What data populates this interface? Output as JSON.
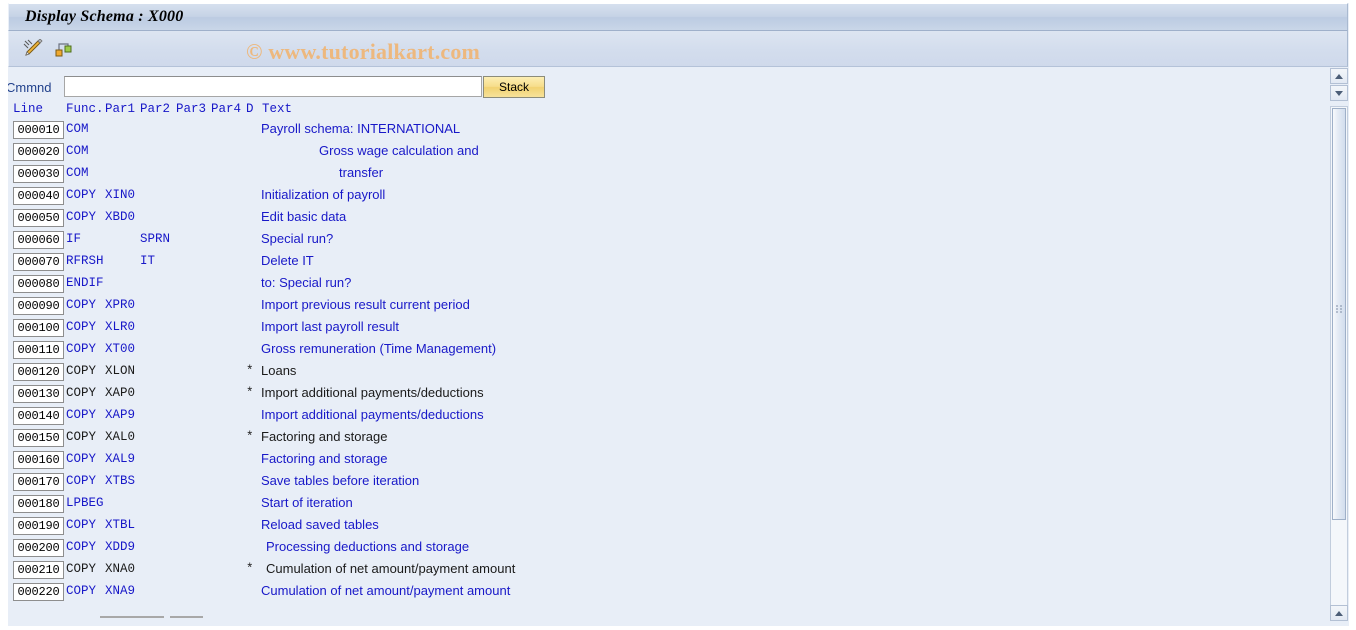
{
  "window": {
    "title": "Display Schema : X000"
  },
  "toolbar": {
    "icons": [
      {
        "name": "edit-pencil-icon",
        "tooltip": "Change"
      },
      {
        "name": "schema-structure-icon",
        "tooltip": "Structure"
      }
    ]
  },
  "watermark": {
    "text": "© www.tutorialkart.com",
    "color": "#edb87e"
  },
  "command": {
    "label": "Cmmnd",
    "value": "",
    "placeholder": "",
    "stack_label": "Stack"
  },
  "table": {
    "headers": {
      "line": "Line",
      "func": "Func.",
      "par1": "Par1",
      "par2": "Par2",
      "par3": "Par3",
      "par4": "Par4",
      "d": "D",
      "text": "Text"
    },
    "rows": [
      {
        "line": "000010",
        "func": "COM",
        "par1": "",
        "par2": "",
        "par3": "",
        "par4": "",
        "d": "",
        "text": "Payroll schema: INTERNATIONAL",
        "color": "blue",
        "indent": 0
      },
      {
        "line": "000020",
        "func": "COM",
        "par1": "",
        "par2": "",
        "par3": "",
        "par4": "",
        "d": "",
        "text": "Gross wage calculation and",
        "color": "blue",
        "indent": 58
      },
      {
        "line": "000030",
        "func": "COM",
        "par1": "",
        "par2": "",
        "par3": "",
        "par4": "",
        "d": "",
        "text": "transfer",
        "color": "blue",
        "indent": 78
      },
      {
        "line": "000040",
        "func": "COPY",
        "par1": "XIN0",
        "par2": "",
        "par3": "",
        "par4": "",
        "d": "",
        "text": "Initialization of payroll",
        "color": "blue",
        "indent": 0
      },
      {
        "line": "000050",
        "func": "COPY",
        "par1": "XBD0",
        "par2": "",
        "par3": "",
        "par4": "",
        "d": "",
        "text": "Edit basic data",
        "color": "blue",
        "indent": 0
      },
      {
        "line": "000060",
        "func": "IF",
        "par1": "",
        "par2": "SPRN",
        "par3": "",
        "par4": "",
        "d": "",
        "text": "Special run?",
        "color": "blue",
        "indent": 0
      },
      {
        "line": "000070",
        "func": "RFRSH",
        "par1": "",
        "par2": "IT",
        "par3": "",
        "par4": "",
        "d": "",
        "text": "Delete IT",
        "color": "blue",
        "indent": 0
      },
      {
        "line": "000080",
        "func": "ENDIF",
        "par1": "",
        "par2": "",
        "par3": "",
        "par4": "",
        "d": "",
        "text": "to: Special run?",
        "color": "blue",
        "indent": 0
      },
      {
        "line": "000090",
        "func": "COPY",
        "par1": "XPR0",
        "par2": "",
        "par3": "",
        "par4": "",
        "d": "",
        "text": "Import previous result current period",
        "color": "blue",
        "indent": 0
      },
      {
        "line": "000100",
        "func": "COPY",
        "par1": "XLR0",
        "par2": "",
        "par3": "",
        "par4": "",
        "d": "",
        "text": "Import last payroll result",
        "color": "blue",
        "indent": 0
      },
      {
        "line": "000110",
        "func": "COPY",
        "par1": "XT00",
        "par2": "",
        "par3": "",
        "par4": "",
        "d": "",
        "text": "Gross remuneration (Time Management)",
        "color": "blue",
        "indent": 0
      },
      {
        "line": "000120",
        "func": "COPY",
        "par1": "XLON",
        "par2": "",
        "par3": "",
        "par4": "",
        "d": "*",
        "text": "Loans",
        "color": "black",
        "indent": 0
      },
      {
        "line": "000130",
        "func": "COPY",
        "par1": "XAP0",
        "par2": "",
        "par3": "",
        "par4": "",
        "d": "*",
        "text": "Import additional payments/deductions",
        "color": "black",
        "indent": 0
      },
      {
        "line": "000140",
        "func": "COPY",
        "par1": "XAP9",
        "par2": "",
        "par3": "",
        "par4": "",
        "d": "",
        "text": "Import additional payments/deductions",
        "color": "blue",
        "indent": 0
      },
      {
        "line": "000150",
        "func": "COPY",
        "par1": "XAL0",
        "par2": "",
        "par3": "",
        "par4": "",
        "d": "*",
        "text": "Factoring and storage",
        "color": "black",
        "indent": 0
      },
      {
        "line": "000160",
        "func": "COPY",
        "par1": "XAL9",
        "par2": "",
        "par3": "",
        "par4": "",
        "d": "",
        "text": "Factoring and storage",
        "color": "blue",
        "indent": 0
      },
      {
        "line": "000170",
        "func": "COPY",
        "par1": "XTBS",
        "par2": "",
        "par3": "",
        "par4": "",
        "d": "",
        "text": "Save tables before iteration",
        "color": "blue",
        "indent": 0
      },
      {
        "line": "000180",
        "func": "LPBEG",
        "par1": "",
        "par2": "",
        "par3": "",
        "par4": "",
        "d": "",
        "text": "Start of iteration",
        "color": "blue",
        "indent": 0
      },
      {
        "line": "000190",
        "func": "COPY",
        "par1": "XTBL",
        "par2": "",
        "par3": "",
        "par4": "",
        "d": "",
        "text": "Reload saved tables",
        "color": "blue",
        "indent": 0
      },
      {
        "line": "000200",
        "func": "COPY",
        "par1": "XDD9",
        "par2": "",
        "par3": "",
        "par4": "",
        "d": "",
        "text": "Processing deductions and storage",
        "color": "blue",
        "indent": 5
      },
      {
        "line": "000210",
        "func": "COPY",
        "par1": "XNA0",
        "par2": "",
        "par3": "",
        "par4": "",
        "d": "*",
        "text": "Cumulation of net amount/payment amount",
        "color": "black",
        "indent": 5
      },
      {
        "line": "000220",
        "func": "COPY",
        "par1": "XNA9",
        "par2": "",
        "par3": "",
        "par4": "",
        "d": "",
        "text": "Cumulation of net amount/payment amount",
        "color": "blue",
        "indent": 0
      }
    ]
  },
  "scroll": {
    "up_arrow": "scroll-up-arrow",
    "down_arrow": "scroll-down-arrow",
    "vertical_thumb": "vertical-scroll-thumb"
  }
}
